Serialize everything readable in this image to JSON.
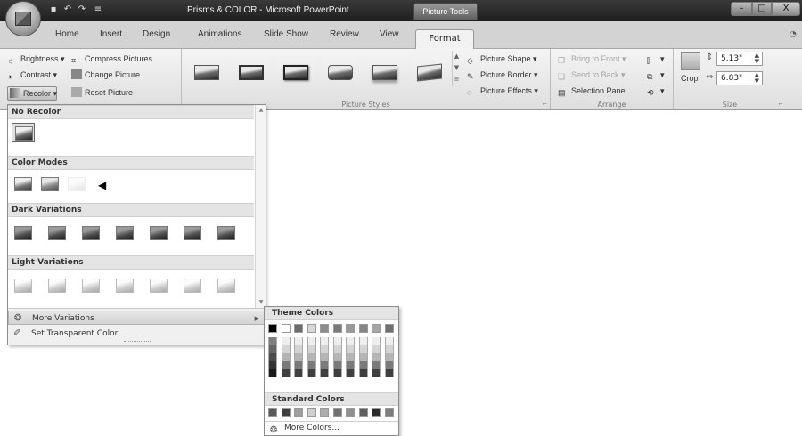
{
  "title_bar": {
    "app_title": "Prisms & COLOR - Microsoft PowerPoint",
    "contextual_tab": "Picture Tools",
    "qat_icons": [
      "save-icon",
      "undo-icon",
      "redo-icon",
      "customize-icon"
    ]
  },
  "window_controls": {
    "minimize": "–",
    "maximize": "□",
    "close": "X"
  },
  "tabs": [
    "Home",
    "Insert",
    "Design",
    "Animations",
    "Slide Show",
    "Review",
    "View",
    "Format"
  ],
  "active_tab": "Format",
  "ribbon": {
    "adjust": {
      "brightness": "Brightness",
      "contrast": "Contrast",
      "recolor": "Recolor",
      "compress": "Compress Pictures",
      "change": "Change Picture",
      "reset": "Reset Picture"
    },
    "picture_styles": {
      "label": "Picture Styles",
      "shape": "Picture Shape",
      "border": "Picture Border",
      "effects": "Picture Effects",
      "thumbnail_count": 6
    },
    "arrange": {
      "label": "Arrange",
      "bring_front": "Bring to Front",
      "send_back": "Send to Back",
      "selection_pane": "Selection Pane"
    },
    "size": {
      "label": "Size",
      "crop": "Crop",
      "height": "5.13\"",
      "width": "6.83\""
    }
  },
  "recolor_menu": {
    "sections": [
      "No Recolor",
      "Color Modes",
      "Dark Variations",
      "Light Variations"
    ],
    "color_mode_styles": [
      "grayscale",
      "sepia",
      "washout",
      "black-and-white"
    ],
    "dark_variation_count": 7,
    "light_variation_count": 7,
    "more_variations": "More Variations",
    "set_transparent": "Set Transparent Color"
  },
  "color_submenu": {
    "theme_colors_label": "Theme Colors",
    "standard_colors_label": "Standard Colors",
    "more_colors": "More Colors...",
    "theme_row": [
      "#000000",
      "#ffffff",
      "#6b6b6b",
      "#d8d8d8",
      "#8c8c8c",
      "#7a7a7a",
      "#9a9a9a",
      "#858585",
      "#a4a4a4",
      "#6f6f6f"
    ],
    "standard_row": [
      "#5a5a5a",
      "#3e3e3e",
      "#9e9e9e",
      "#cfcfcf",
      "#adadad",
      "#707070",
      "#8f8f8f",
      "#5f5f5f",
      "#2b2b2b",
      "#7d7d7d"
    ]
  }
}
